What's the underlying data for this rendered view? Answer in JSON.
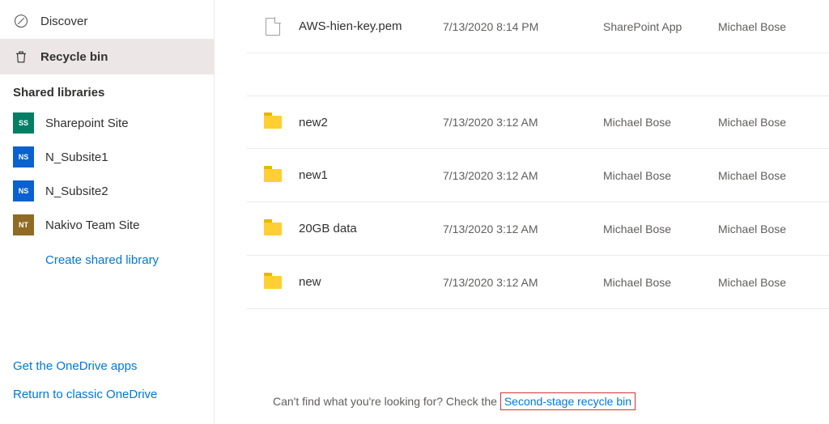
{
  "sidebar": {
    "nav": [
      {
        "label": "Discover",
        "icon": "discover"
      },
      {
        "label": "Recycle bin",
        "icon": "recycle",
        "selected": true
      }
    ],
    "shared_header": "Shared libraries",
    "libraries": [
      {
        "label": "Sharepoint Site",
        "badge": "SS",
        "color": "#027e65"
      },
      {
        "label": "N_Subsite1",
        "badge": "NS",
        "color": "#0a61cf"
      },
      {
        "label": "N_Subsite2",
        "badge": "NS",
        "color": "#0a61cf"
      },
      {
        "label": "Nakivo Team Site",
        "badge": "NT",
        "color": "#8f6b24"
      }
    ],
    "create_label": "Create shared library",
    "footer": {
      "apps": "Get the OneDrive apps",
      "classic": "Return to classic OneDrive"
    }
  },
  "files": [
    {
      "type": "file",
      "name": "AWS-hien-key.pem",
      "date": "7/13/2020 8:14 PM",
      "u1": "SharePoint App",
      "u2": "Michael Bose"
    },
    {
      "type": "folder",
      "name": "new2",
      "date": "7/13/2020 3:12 AM",
      "u1": "Michael Bose",
      "u2": "Michael Bose"
    },
    {
      "type": "folder",
      "name": "new1",
      "date": "7/13/2020 3:12 AM",
      "u1": "Michael Bose",
      "u2": "Michael Bose"
    },
    {
      "type": "folder",
      "name": "20GB data",
      "date": "7/13/2020 3:12 AM",
      "u1": "Michael Bose",
      "u2": "Michael Bose"
    },
    {
      "type": "folder",
      "name": "new",
      "date": "7/13/2020 3:12 AM",
      "u1": "Michael Bose",
      "u2": "Michael Bose"
    }
  ],
  "help": {
    "prefix": "Can't find what you're looking for? Check the ",
    "link": "Second-stage recycle bin"
  }
}
